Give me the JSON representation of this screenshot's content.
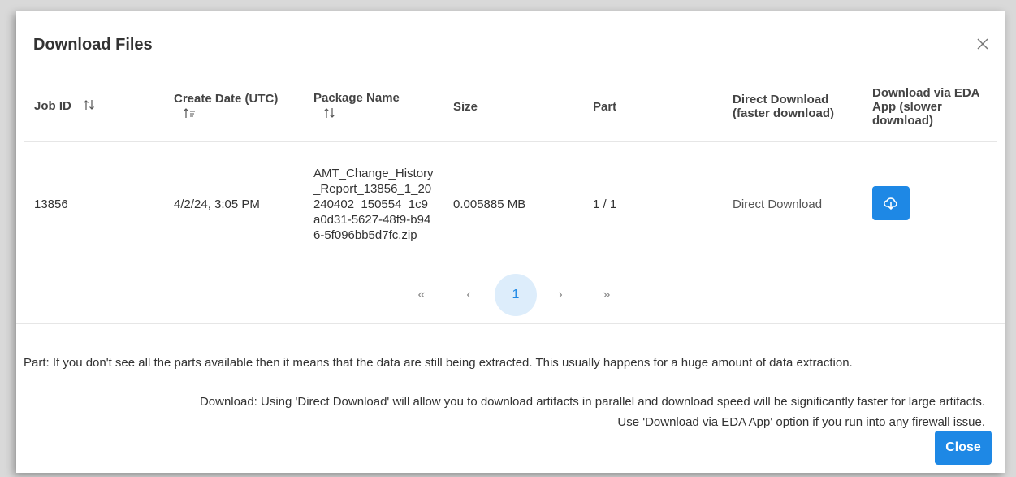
{
  "dialog": {
    "title": "Download Files"
  },
  "table": {
    "headers": {
      "job_id": "Job ID",
      "create_date": "Create Date (UTC)",
      "package_name": "Package Name",
      "size": "Size",
      "part": "Part",
      "direct_download": "Direct Download (faster download)",
      "eda_download": "Download via EDA App (slower download)"
    },
    "rows": [
      {
        "job_id": "13856",
        "create_date": "4/2/24, 3:05 PM",
        "package_name": "AMT_Change_History_Report_13856_1_20240402_150554_1c9a0d31-5627-48f9-b946-5f096bb5d7fc.zip",
        "size": "0.005885 MB",
        "part": "1 / 1",
        "direct_download_link": "Direct Download",
        "eda_icon": "cloud-download-icon"
      }
    ]
  },
  "pagination": {
    "first": "«",
    "prev": "‹",
    "current_page": "1",
    "next": "›",
    "last": "»"
  },
  "notes": {
    "part": "Part: If you don't see all the parts available then it means that the data are still being extracted. This usually happens for a huge amount of data extraction.",
    "download_line1": "Download: Using 'Direct Download' will allow you to download artifacts in parallel and download speed will be significantly faster for large artifacts.",
    "download_line2": "Use 'Download via EDA App' option if you run into any firewall issue."
  },
  "footer": {
    "close_label": "Close"
  },
  "colors": {
    "accent": "#1e88e5",
    "page_highlight": "#ddedfb"
  }
}
